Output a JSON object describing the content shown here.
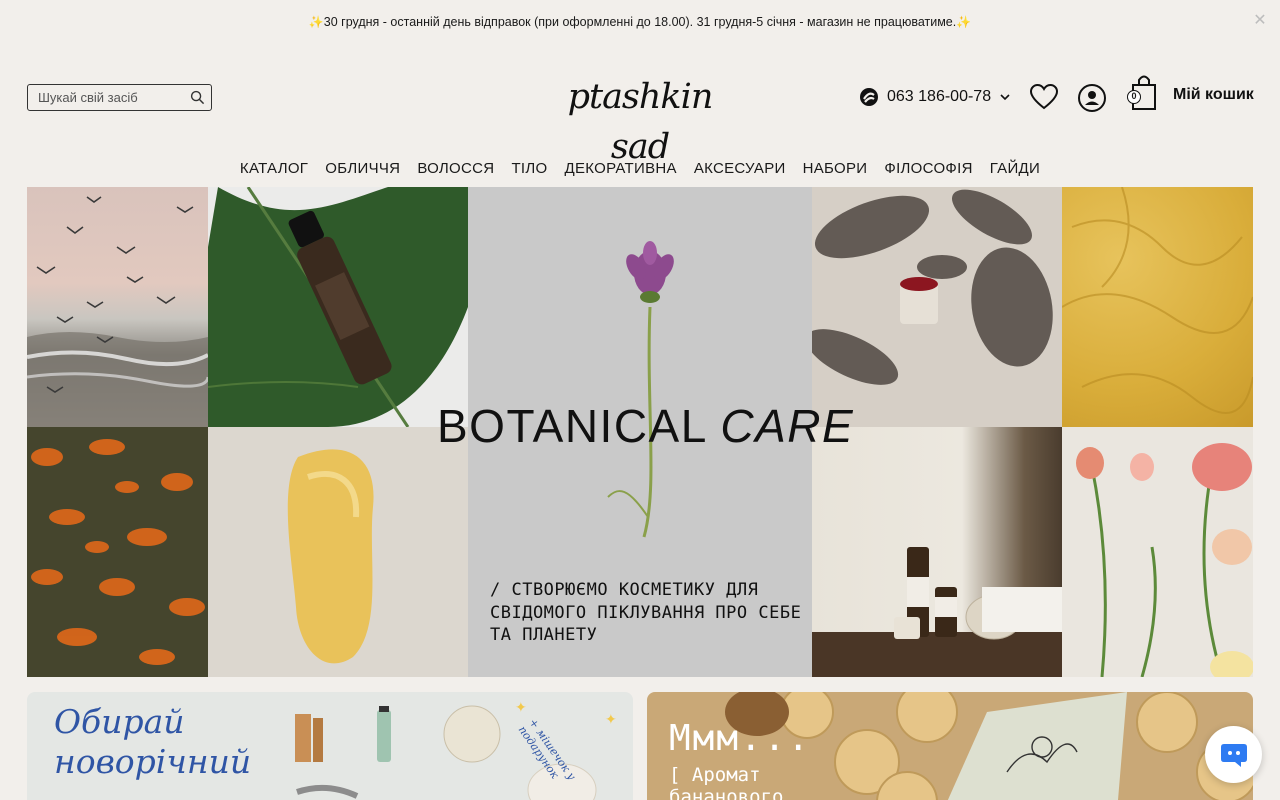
{
  "announcement": {
    "text": "30 грудня - останній день відправок (при оформленні до 18.00). 31 грудня-5 січня - магазин не працюватиме.",
    "spark_icon": "sparkle-icon",
    "close_icon": "close-icon"
  },
  "header": {
    "search_placeholder": "Шукай свій засіб",
    "logo": "ptashkin sad",
    "phone": "063 186-00-78",
    "cart_count": "0",
    "cart_label": "Мій кошик"
  },
  "nav": {
    "items": [
      "КАТАЛОГ",
      "ОБЛИЧЧЯ",
      "ВОЛОССЯ",
      "ТІЛО",
      "ДЕКОРАТИВНА",
      "АКСЕСУАРИ",
      "НАБОРИ",
      "ФІЛОСОФІЯ",
      "ГАЙДИ"
    ]
  },
  "hero": {
    "title_main": "BOTANICAL",
    "title_italic": "CARE",
    "subtitle": "/ СТВОРЮЄМО КОСМЕТИКУ ДЛЯ СВІДОМОГО ПІКЛУВАННЯ ПРО СЕБЕ ТА ПЛАНЕТУ"
  },
  "promo": {
    "left_line1": "Обирай",
    "left_line2": "новорічний",
    "left_gift": "+ мішечок у подарунок",
    "right_title": "Ммм...",
    "right_line1": "[ Аромат",
    "right_line2": "бананового"
  },
  "colors": {
    "background": "#f2efeb",
    "accent_blue": "#2f55a5",
    "chat_blue": "#2e7bf2"
  }
}
